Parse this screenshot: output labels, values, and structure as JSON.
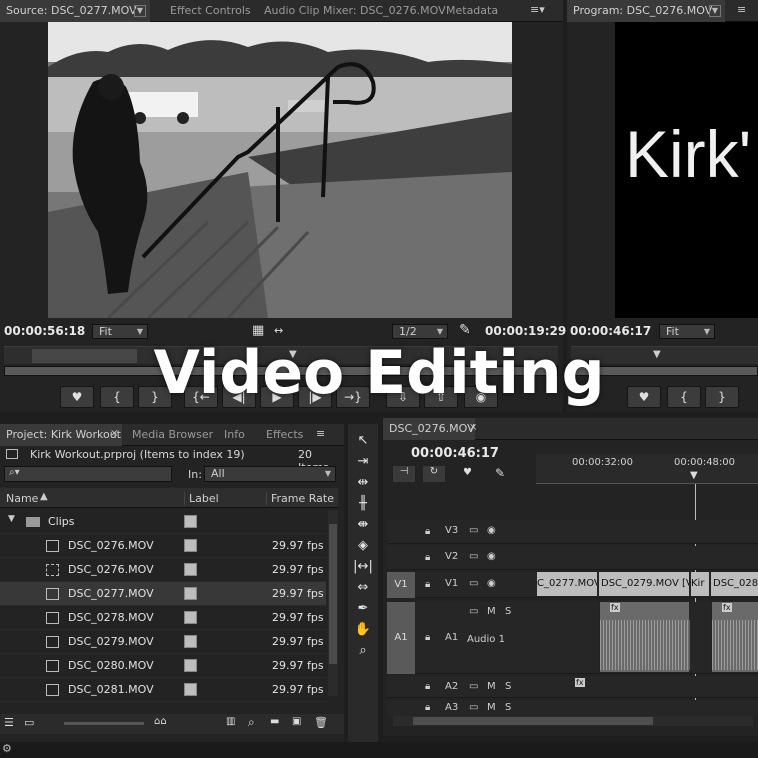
{
  "source_monitor": {
    "tabs": [
      "Source: DSC_0277.MOV",
      "Effect Controls",
      "Audio Clip Mixer: DSC_0276.MOV",
      "Metadata"
    ],
    "timecode_current": "00:00:56:18",
    "zoom": "Fit",
    "resolution": "1/2",
    "timecode_duration": "00:00:19:29"
  },
  "program_monitor": {
    "tab": "Program: DSC_0276.MOV",
    "title_text": "Kirk'",
    "timecode_current": "00:00:46:17",
    "zoom": "Fit"
  },
  "overlay_title": "Video Editing",
  "transport": {
    "marker": "♥",
    "in": "{",
    "out": "}",
    "goto_in": "{←",
    "step_back": "◀|",
    "play": "▶",
    "step_fwd": "|▶",
    "goto_out": "→}",
    "insert": "⇩",
    "overwrite": "⇧",
    "export_frame": "◉"
  },
  "project": {
    "tabs": [
      "Project: Kirk Workout",
      "Media Browser",
      "Info",
      "Effects"
    ],
    "file": "Kirk Workout.prproj (Items to index 19)",
    "item_count": "20 Items",
    "search_placeholder": "",
    "in_label": "In:",
    "in_value": "All",
    "columns": [
      "Name",
      "Label",
      "Frame Rate"
    ],
    "folder": "Clips",
    "clips": [
      {
        "name": "DSC_0276.MOV",
        "fps": "29.97 fps"
      },
      {
        "name": "DSC_0276.MOV",
        "fps": "29.97 fps"
      },
      {
        "name": "DSC_0277.MOV",
        "fps": "29.97 fps"
      },
      {
        "name": "DSC_0278.MOV",
        "fps": "29.97 fps"
      },
      {
        "name": "DSC_0279.MOV",
        "fps": "29.97 fps"
      },
      {
        "name": "DSC_0280.MOV",
        "fps": "29.97 fps"
      },
      {
        "name": "DSC_0281.MOV",
        "fps": "29.97 fps"
      }
    ]
  },
  "timeline": {
    "tab": "DSC_0276.MOV",
    "timecode": "00:00:46:17",
    "ruler": [
      "00:00:32:00",
      "00:00:48:00"
    ],
    "tracks": {
      "v3": "V3",
      "v2": "V2",
      "v1": "V1",
      "v1_src": "V1",
      "a1": "A1",
      "a1_src": "A1",
      "a1_name": "Audio 1",
      "a2": "A2",
      "a3": "A3",
      "m": "M",
      "s": "S"
    },
    "clips": [
      "C_0277.MOV",
      "DSC_0279.MOV [V]",
      "Kir",
      "DSC_028"
    ],
    "fx": "fx"
  }
}
